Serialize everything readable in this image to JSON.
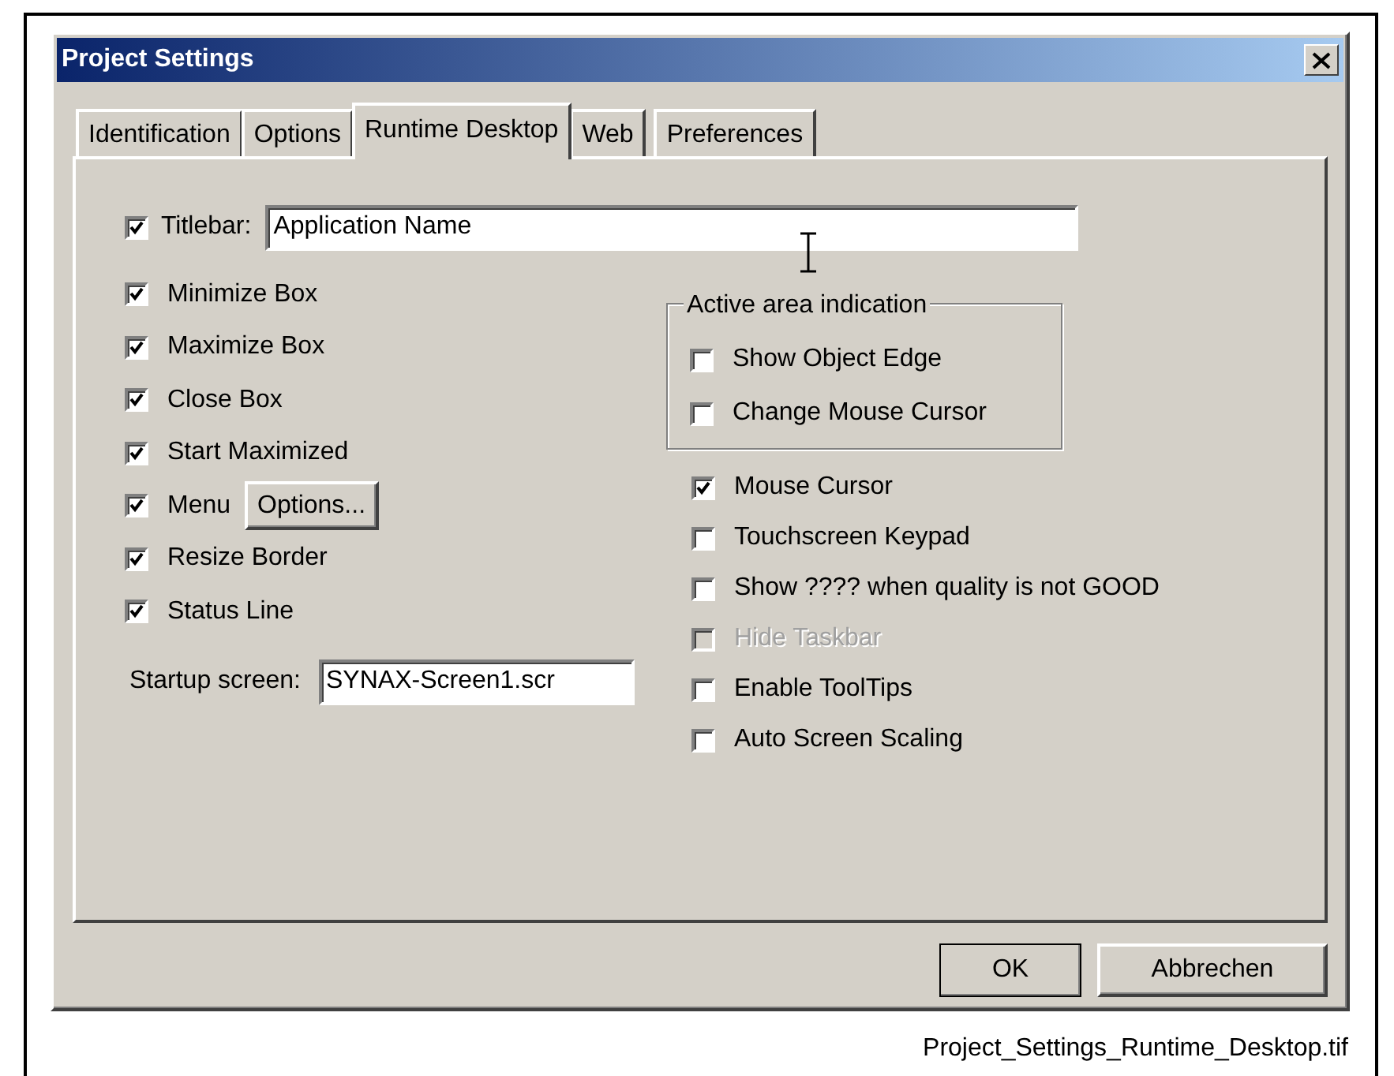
{
  "window": {
    "title": "Project Settings"
  },
  "tabs": [
    {
      "label": "Identification",
      "selected": false
    },
    {
      "label": "Options",
      "selected": false
    },
    {
      "label": "Runtime Desktop",
      "selected": true
    },
    {
      "label": "Web",
      "selected": false
    },
    {
      "label": "Preferences",
      "selected": false
    }
  ],
  "titlebar": {
    "label": "Titlebar:",
    "checked": true,
    "value": "Application Name"
  },
  "left_options": [
    {
      "kind": "checkbox",
      "label": "Minimize Box",
      "checked": true
    },
    {
      "kind": "checkbox",
      "label": "Maximize Box",
      "checked": true
    },
    {
      "kind": "checkbox",
      "label": "Close Box",
      "checked": true
    },
    {
      "kind": "checkbox",
      "label": "Start Maximized",
      "checked": true
    },
    {
      "kind": "checkbox_button",
      "label": "Menu",
      "checked": true,
      "button": "Options..."
    },
    {
      "kind": "checkbox",
      "label": "Resize Border",
      "checked": true
    },
    {
      "kind": "checkbox",
      "label": "Status Line",
      "checked": true
    }
  ],
  "startup_screen": {
    "label": "Startup screen:",
    "value": "SYNAX-Screen1.scr"
  },
  "active_area": {
    "title": "Active area indication",
    "options": [
      {
        "label": "Show Object Edge",
        "checked": false
      },
      {
        "label": "Change Mouse Cursor",
        "checked": false
      }
    ]
  },
  "right_options": [
    {
      "label": "Mouse Cursor",
      "checked": true,
      "disabled": false
    },
    {
      "label": "Touchscreen Keypad",
      "checked": false,
      "disabled": false
    },
    {
      "label": "Show ???? when quality is not GOOD",
      "checked": false,
      "disabled": false
    },
    {
      "label": "Hide Taskbar",
      "checked": false,
      "disabled": true
    },
    {
      "label": "Enable ToolTips",
      "checked": false,
      "disabled": false
    },
    {
      "label": "Auto Screen Scaling",
      "checked": false,
      "disabled": false
    }
  ],
  "buttons": [
    {
      "label": "OK",
      "default": true
    },
    {
      "label": "Abbrechen",
      "default": false
    }
  ],
  "caption": "Project_Settings_Runtime_Desktop.tif"
}
